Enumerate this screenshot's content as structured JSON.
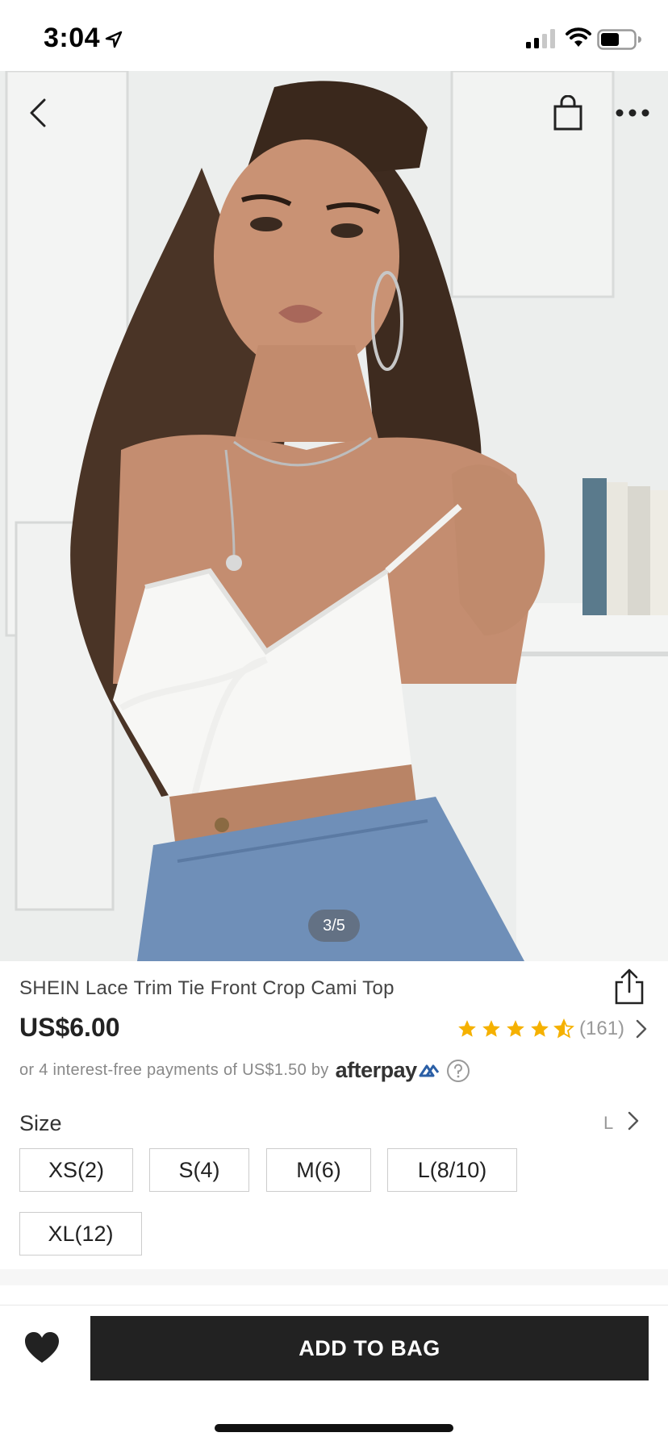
{
  "status_bar": {
    "time": "3:04",
    "icons": [
      "location-arrow-icon",
      "cellular-signal-icon",
      "wifi-icon",
      "battery-icon"
    ]
  },
  "gallery": {
    "pager": "3/5",
    "nav_icons": [
      "back-chevron-icon",
      "shopping-bag-icon",
      "more-dots-icon"
    ]
  },
  "product": {
    "title": "SHEIN Lace Trim Tie Front Crop Cami Top",
    "price": "US$6.00",
    "rating": {
      "stars": 4.5,
      "count": "(161)",
      "star_color": "#f5b100"
    },
    "afterpay": {
      "text": "or 4 interest-free payments of US$1.50 by",
      "logo": "afterpay"
    }
  },
  "size": {
    "label": "Size",
    "selected": "L",
    "options": [
      "XS(2)",
      "S(4)",
      "M(6)",
      "L(8/10)",
      "XL(12)"
    ]
  },
  "actions": {
    "add_to_bag": "ADD TO BAG",
    "wishlist_icon": "heart-icon"
  },
  "colors": {
    "primary_button": "#222222",
    "star": "#f5b100",
    "afterpay_accent": "#2b5fa6"
  }
}
